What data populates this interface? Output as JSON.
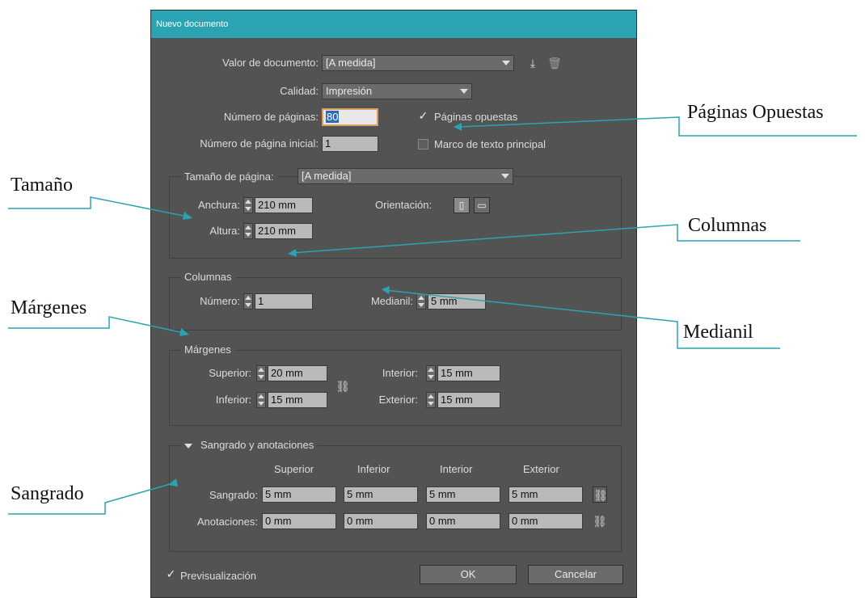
{
  "dialog": {
    "title": "Nuevo documento",
    "preset": {
      "label": "Valor de documento:",
      "value": "[A medida]"
    },
    "quality": {
      "label": "Calidad:",
      "value": "Impresión"
    },
    "num_pages": {
      "label": "Número de páginas:",
      "value": "80"
    },
    "start_page": {
      "label": "Número de página inicial:",
      "value": "1"
    },
    "facing_pages": {
      "label": "Páginas opuestas",
      "checked": true
    },
    "primary_text_frame": {
      "label": "Marco de texto principal",
      "checked": false
    },
    "page_size": {
      "legend": "Tamaño de página:",
      "value": "[A medida]",
      "width_label": "Anchura:",
      "width_value": "210 mm",
      "height_label": "Altura:",
      "height_value": "210 mm",
      "orientation_label": "Orientación:"
    },
    "columns": {
      "legend": "Columnas",
      "number_label": "Número:",
      "number_value": "1",
      "gutter_label": "Medianil:",
      "gutter_value": "5 mm"
    },
    "margins": {
      "legend": "Márgenes",
      "top_label": "Superior:",
      "top_value": "20 mm",
      "bottom_label": "Inferior:",
      "bottom_value": "15 mm",
      "inside_label": "Interior:",
      "inside_value": "15 mm",
      "outside_label": "Exterior:",
      "outside_value": "15 mm"
    },
    "bleed": {
      "legend": "Sangrado y anotaciones",
      "col_headers": [
        "Superior",
        "Inferior",
        "Interior",
        "Exterior"
      ],
      "bleed_label": "Sangrado:",
      "bleed_values": [
        "5 mm",
        "5 mm",
        "5 mm",
        "5 mm"
      ],
      "slug_label": "Anotaciones:",
      "slug_values": [
        "0 mm",
        "0 mm",
        "0 mm",
        "0 mm"
      ]
    },
    "preview": {
      "label": "Previsualización",
      "checked": true
    },
    "ok_label": "OK",
    "cancel_label": "Cancelar",
    "icons": {
      "save_preset": "download-icon",
      "delete_preset": "trash-icon",
      "portrait": "portrait-orientation-icon",
      "landscape": "landscape-orientation-icon",
      "link": "chain-link-icon"
    }
  },
  "annotations": {
    "paginas_opuestas": "Páginas Opuestas",
    "tamano": "Tamaño",
    "columnas": "Columnas",
    "margenes": "Márgenes",
    "medianil": "Medianil",
    "sangrado": "Sangrado"
  },
  "colors": {
    "titlebar": "#2aa3b2",
    "dialog_bg": "#535353",
    "annotation_line": "#2aa3b2"
  }
}
